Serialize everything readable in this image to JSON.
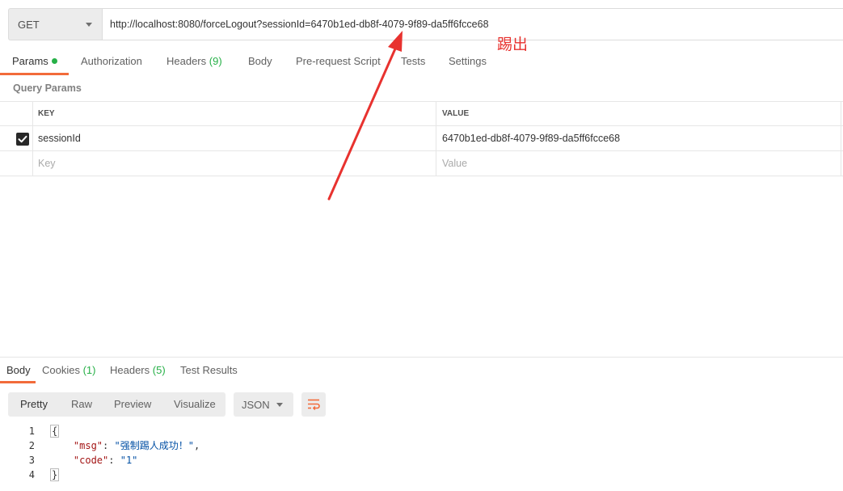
{
  "request": {
    "method": "GET",
    "url": "http://localhost:8080/forceLogout?sessionId=6470b1ed-db8f-4079-9f89-da5ff6fcce68"
  },
  "annotation": {
    "text": "踢出",
    "color": "#e8322f"
  },
  "request_tabs": [
    {
      "label": "Params",
      "active": true,
      "indicator": "green-dot"
    },
    {
      "label": "Authorization"
    },
    {
      "label": "Headers",
      "count": "(9)"
    },
    {
      "label": "Body"
    },
    {
      "label": "Pre-request Script"
    },
    {
      "label": "Tests"
    },
    {
      "label": "Settings"
    }
  ],
  "query_params": {
    "title": "Query Params",
    "columns": {
      "key": "KEY",
      "value": "VALUE"
    },
    "rows": [
      {
        "checked": true,
        "key": "sessionId",
        "value": "6470b1ed-db8f-4079-9f89-da5ff6fcce68"
      }
    ],
    "placeholder": {
      "key": "Key",
      "value": "Value"
    }
  },
  "response_tabs": [
    {
      "label": "Body",
      "active": true
    },
    {
      "label": "Cookies",
      "count": "(1)"
    },
    {
      "label": "Headers",
      "count": "(5)"
    },
    {
      "label": "Test Results"
    }
  ],
  "response_view": {
    "modes": [
      "Pretty",
      "Raw",
      "Preview",
      "Visualize"
    ],
    "active_mode": "Pretty",
    "format": "JSON",
    "wrap_icon": "text-wrap-icon"
  },
  "response_body": {
    "line_numbers": [
      "1",
      "2",
      "3",
      "4"
    ],
    "open_brace": "{",
    "close_brace": "}",
    "fields": [
      {
        "key": "\"msg\"",
        "value": "\"强制踢人成功！\"",
        "sep": ": ",
        "trail": ","
      },
      {
        "key": "\"code\"",
        "value": "\"1\"",
        "sep": ": ",
        "trail": ""
      }
    ]
  },
  "colors": {
    "accent": "#f26b3a",
    "count_green": "#26b047",
    "arrow_red": "#e8322f"
  }
}
